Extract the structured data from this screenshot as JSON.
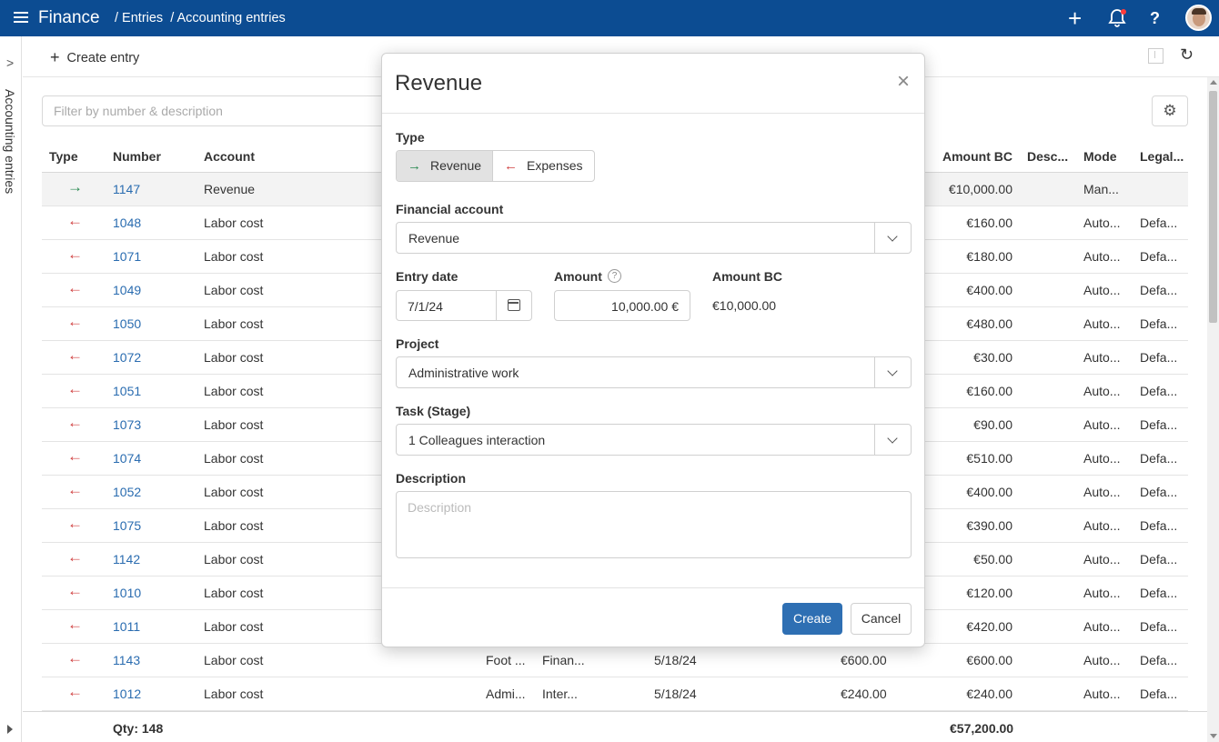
{
  "topbar": {
    "app_title": "Finance",
    "breadcrumb": [
      "/ Entries",
      "/ Accounting entries"
    ],
    "plus_glyph": "+",
    "help_glyph": "?"
  },
  "leftrail": {
    "vertical_label": "Accounting entries"
  },
  "toolbar": {
    "create_label": "Create entry"
  },
  "filter": {
    "placeholder": "Filter by number & description",
    "value": ""
  },
  "table": {
    "headers": {
      "type": "Type",
      "number": "Number",
      "account": "Account",
      "amount_bc": "Amount BC",
      "description": "Desc...",
      "mode": "Mode",
      "legal": "Legal..."
    },
    "rows": [
      {
        "dir": "in",
        "arrow": "→",
        "number": "1147",
        "account": "Revenue",
        "c5": "",
        "c6": "",
        "c7": "",
        "c8": "",
        "amount_bc": "€10,000.00",
        "mode": "Man...",
        "legal": ""
      },
      {
        "dir": "out",
        "arrow": "←",
        "number": "1048",
        "account": "Labor cost",
        "c5": "",
        "c6": "",
        "c7": "",
        "c8": "",
        "amount_bc": "€160.00",
        "mode": "Auto...",
        "legal": "Defa..."
      },
      {
        "dir": "out",
        "arrow": "←",
        "number": "1071",
        "account": "Labor cost",
        "c5": "",
        "c6": "",
        "c7": "",
        "c8": "",
        "amount_bc": "€180.00",
        "mode": "Auto...",
        "legal": "Defa..."
      },
      {
        "dir": "out",
        "arrow": "←",
        "number": "1049",
        "account": "Labor cost",
        "c5": "",
        "c6": "",
        "c7": "",
        "c8": "",
        "amount_bc": "€400.00",
        "mode": "Auto...",
        "legal": "Defa..."
      },
      {
        "dir": "out",
        "arrow": "←",
        "number": "1050",
        "account": "Labor cost",
        "c5": "",
        "c6": "",
        "c7": "",
        "c8": "",
        "amount_bc": "€480.00",
        "mode": "Auto...",
        "legal": "Defa..."
      },
      {
        "dir": "out",
        "arrow": "←",
        "number": "1072",
        "account": "Labor cost",
        "c5": "",
        "c6": "",
        "c7": "",
        "c8": "",
        "amount_bc": "€30.00",
        "mode": "Auto...",
        "legal": "Defa..."
      },
      {
        "dir": "out",
        "arrow": "←",
        "number": "1051",
        "account": "Labor cost",
        "c5": "",
        "c6": "",
        "c7": "",
        "c8": "",
        "amount_bc": "€160.00",
        "mode": "Auto...",
        "legal": "Defa..."
      },
      {
        "dir": "out",
        "arrow": "←",
        "number": "1073",
        "account": "Labor cost",
        "c5": "",
        "c6": "",
        "c7": "",
        "c8": "",
        "amount_bc": "€90.00",
        "mode": "Auto...",
        "legal": "Defa..."
      },
      {
        "dir": "out",
        "arrow": "←",
        "number": "1074",
        "account": "Labor cost",
        "c5": "",
        "c6": "",
        "c7": "",
        "c8": "",
        "amount_bc": "€510.00",
        "mode": "Auto...",
        "legal": "Defa..."
      },
      {
        "dir": "out",
        "arrow": "←",
        "number": "1052",
        "account": "Labor cost",
        "c5": "",
        "c6": "",
        "c7": "",
        "c8": "",
        "amount_bc": "€400.00",
        "mode": "Auto...",
        "legal": "Defa..."
      },
      {
        "dir": "out",
        "arrow": "←",
        "number": "1075",
        "account": "Labor cost",
        "c5": "",
        "c6": "",
        "c7": "",
        "c8": "",
        "amount_bc": "€390.00",
        "mode": "Auto...",
        "legal": "Defa..."
      },
      {
        "dir": "out",
        "arrow": "←",
        "number": "1142",
        "account": "Labor cost",
        "c5": "",
        "c6": "",
        "c7": "",
        "c8": "",
        "amount_bc": "€50.00",
        "mode": "Auto...",
        "legal": "Defa..."
      },
      {
        "dir": "out",
        "arrow": "←",
        "number": "1010",
        "account": "Labor cost",
        "c5": "",
        "c6": "",
        "c7": "",
        "c8": "",
        "amount_bc": "€120.00",
        "mode": "Auto...",
        "legal": "Defa..."
      },
      {
        "dir": "out",
        "arrow": "←",
        "number": "1011",
        "account": "Labor cost",
        "c5": "",
        "c6": "",
        "c7": "",
        "c8": "",
        "amount_bc": "€420.00",
        "mode": "Auto...",
        "legal": "Defa..."
      },
      {
        "dir": "out",
        "arrow": "←",
        "number": "1143",
        "account": "Labor cost",
        "c5": "Foot ...",
        "c6": "Finan...",
        "c7": "5/18/24",
        "c8": "€600.00",
        "amount_bc": "€600.00",
        "mode": "Auto...",
        "legal": "Defa..."
      },
      {
        "dir": "out",
        "arrow": "←",
        "number": "1012",
        "account": "Labor cost",
        "c5": "Admi...",
        "c6": "Inter...",
        "c7": "5/18/24",
        "c8": "€240.00",
        "amount_bc": "€240.00",
        "mode": "Auto...",
        "legal": "Defa..."
      }
    ]
  },
  "footer": {
    "qty": "Qty: 148",
    "total": "€57,200.00"
  },
  "modal": {
    "title": "Revenue",
    "close_glyph": "×",
    "type_label": "Type",
    "type_options": [
      {
        "label": "Revenue",
        "arrow": "→",
        "active": true
      },
      {
        "label": "Expenses",
        "arrow": "←",
        "active": false
      }
    ],
    "financial_account_label": "Financial account",
    "financial_account_value": "Revenue",
    "entry_date_label": "Entry date",
    "entry_date_value": "7/1/24",
    "amount_label": "Amount",
    "amount_help_glyph": "?",
    "amount_value": "10,000.00 €",
    "amount_bc_label": "Amount BC",
    "amount_bc_value": "€10,000.00",
    "project_label": "Project",
    "project_value": "Administrative work",
    "task_label": "Task (Stage)",
    "task_value": "1 Colleagues interaction",
    "description_label": "Description",
    "description_placeholder": "Description",
    "create_label": "Create",
    "cancel_label": "Cancel"
  },
  "colors": {
    "topbar": "#0c4c92",
    "link": "#2a6cb0",
    "arrow_in": "#2a8a52",
    "arrow_out": "#d04040",
    "primary_button": "#2e6fb3"
  },
  "icons": [
    "menu-icon",
    "plus-icon",
    "bell-icon",
    "help-icon",
    "avatar",
    "chevron-right-icon",
    "export-icon",
    "refresh-icon",
    "settings-icon",
    "calendar-icon",
    "chevron-down-icon",
    "close-icon"
  ]
}
